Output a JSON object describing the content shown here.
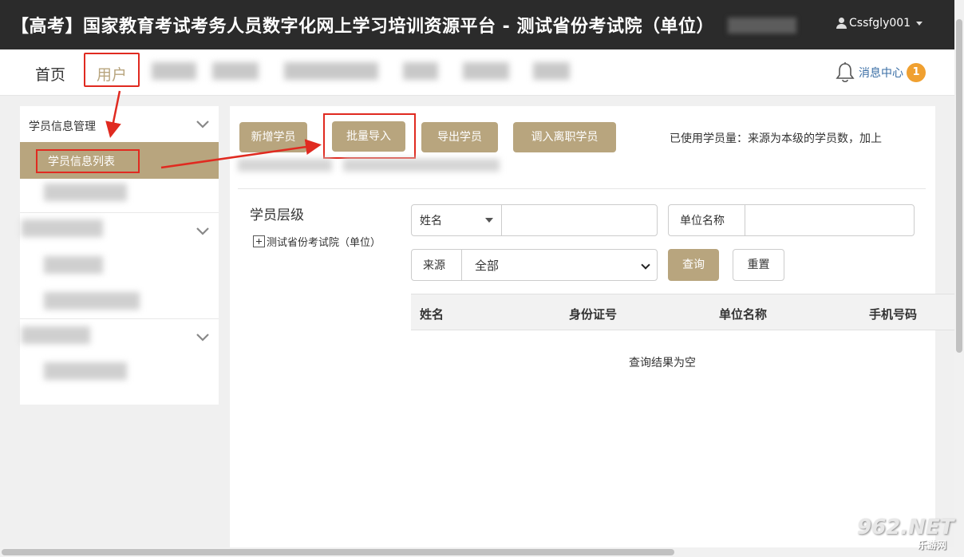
{
  "header": {
    "title": "【高考】国家教育考试考务人员数字化网上学习培训资源平台 - 测试省份考试院（单位）",
    "username": "Cssfgly001"
  },
  "nav": {
    "home": "首页",
    "user": "用户",
    "message_center": "消息中心",
    "message_count": "1"
  },
  "sidebar": {
    "group1_title": "学员信息管理",
    "active_item": "学员信息列表"
  },
  "toolbar": {
    "add_student": "新增学员",
    "batch_import": "批量导入",
    "export_students": "导出学员",
    "transfer_students": "调入离职学员",
    "quota_text": "已使用学员量：来源为本级的学员数，加上"
  },
  "tree": {
    "title": "学员层级",
    "root_node": "测试省份考试院（单位）"
  },
  "filters": {
    "name_select": "姓名",
    "unit_name_label": "单位名称",
    "source_label": "来源",
    "source_value": "全部",
    "query_button": "查询",
    "reset_button": "重置"
  },
  "table": {
    "columns": [
      "姓名",
      "身份证号",
      "单位名称",
      "手机号码"
    ],
    "empty_text": "查询结果为空"
  },
  "watermark": {
    "main": "962.NET",
    "sub": "乐游网"
  },
  "colors": {
    "accent": "#b8a57e",
    "header_bg": "#2b2b2b",
    "highlight_red": "#e02a20",
    "badge": "#f0a030"
  }
}
